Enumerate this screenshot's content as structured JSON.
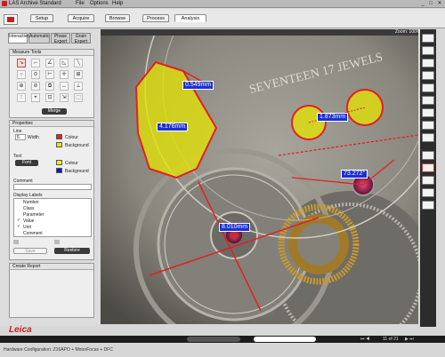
{
  "app": {
    "title": "LAS Archive Standard",
    "menu": [
      "File",
      "Options",
      "Help"
    ]
  },
  "window_controls": {
    "minimize": "_",
    "maximize": "□",
    "close": "✕"
  },
  "app_tabs": [
    "Setup",
    "Acquire",
    "Browse",
    "Process",
    "Analysis"
  ],
  "sub_tabs": [
    {
      "label": "Interactive"
    },
    {
      "label": "Automatic"
    },
    {
      "label": "Phase Expert"
    },
    {
      "label": "Grain Expert"
    }
  ],
  "measure_tools": {
    "title": "Measure Tools",
    "merge_label": "Merge",
    "tools": [
      "↘",
      "⌐",
      "∠",
      "◺",
      "╲",
      "○",
      "⊙",
      "⊢",
      "✛",
      "⊞",
      "⊕",
      "⊘",
      "⧉",
      "↔",
      "⟂",
      "⁝",
      "⌖",
      "⊡",
      "⇲",
      "⬚",
      "⬡"
    ]
  },
  "properties": {
    "title": "Properties",
    "line_label": "Line",
    "width_value": "5",
    "width_label": "Width",
    "colour_label": "Colour",
    "background_label": "Background",
    "text_label": "Text",
    "font_label": "Font",
    "comment_label": "Comment",
    "comment_value": "",
    "line_colour": "#e32020",
    "line_bg": "#e6e600",
    "text_colour": "#f2f200",
    "text_bg": "#1018c8",
    "display_labels_title": "Display Labels",
    "display_labels": [
      {
        "label": "Number",
        "checked": false
      },
      {
        "label": "Class",
        "checked": false
      },
      {
        "label": "Parameter",
        "checked": false
      },
      {
        "label": "Value",
        "checked": true
      },
      {
        "label": "Unit",
        "checked": true
      },
      {
        "label": "Comment",
        "checked": false
      }
    ],
    "save_label": "Save",
    "restore_label": "Restore"
  },
  "create_report": {
    "title": "Create Report"
  },
  "viewer": {
    "zoom": "Zoom: 100%"
  },
  "measurements": [
    {
      "value": "0.549mm"
    },
    {
      "value": "4.176mm"
    },
    {
      "value": "1.873mm"
    },
    {
      "value": "73.272°"
    },
    {
      "value": "8.010mm"
    }
  ],
  "image_text": {
    "engraving": "SEVENTEEN 17 JEWELS"
  },
  "status": {
    "page": "11 of 21"
  },
  "branding": {
    "logo": "Leica"
  },
  "hardware": {
    "config": "Hardware Configuration: Z16APO + MotorFocus + DFC"
  }
}
